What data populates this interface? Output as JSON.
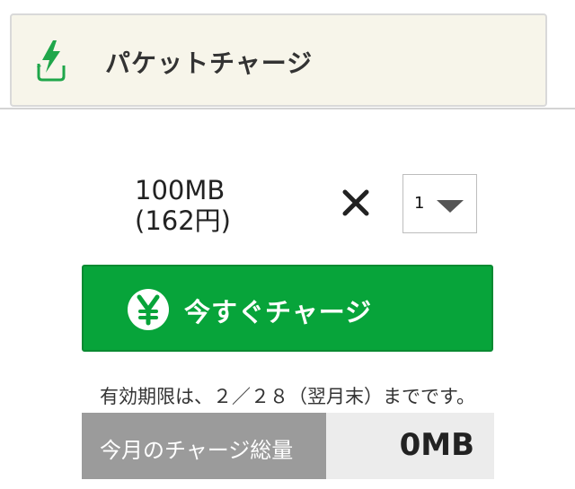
{
  "header": {
    "title": "パケットチャージ",
    "icon": "lightning-charge-icon",
    "background_color": "#f7f5ea"
  },
  "plan": {
    "size_label": "100MB",
    "price_label": "(162円)",
    "multiply_symbol_icon": "times-icon"
  },
  "quantity": {
    "value": "1",
    "icon": "dropdown-triangle-icon"
  },
  "charge": {
    "button_label": "今すぐチャージ",
    "icon": "yen-circle-icon",
    "button_color": "#07a43a"
  },
  "expiry": {
    "text": "有効期限は、２／２８（翌月末）までです。"
  },
  "monthly_total": {
    "label": "今月のチャージ総量",
    "value": "0MB"
  }
}
